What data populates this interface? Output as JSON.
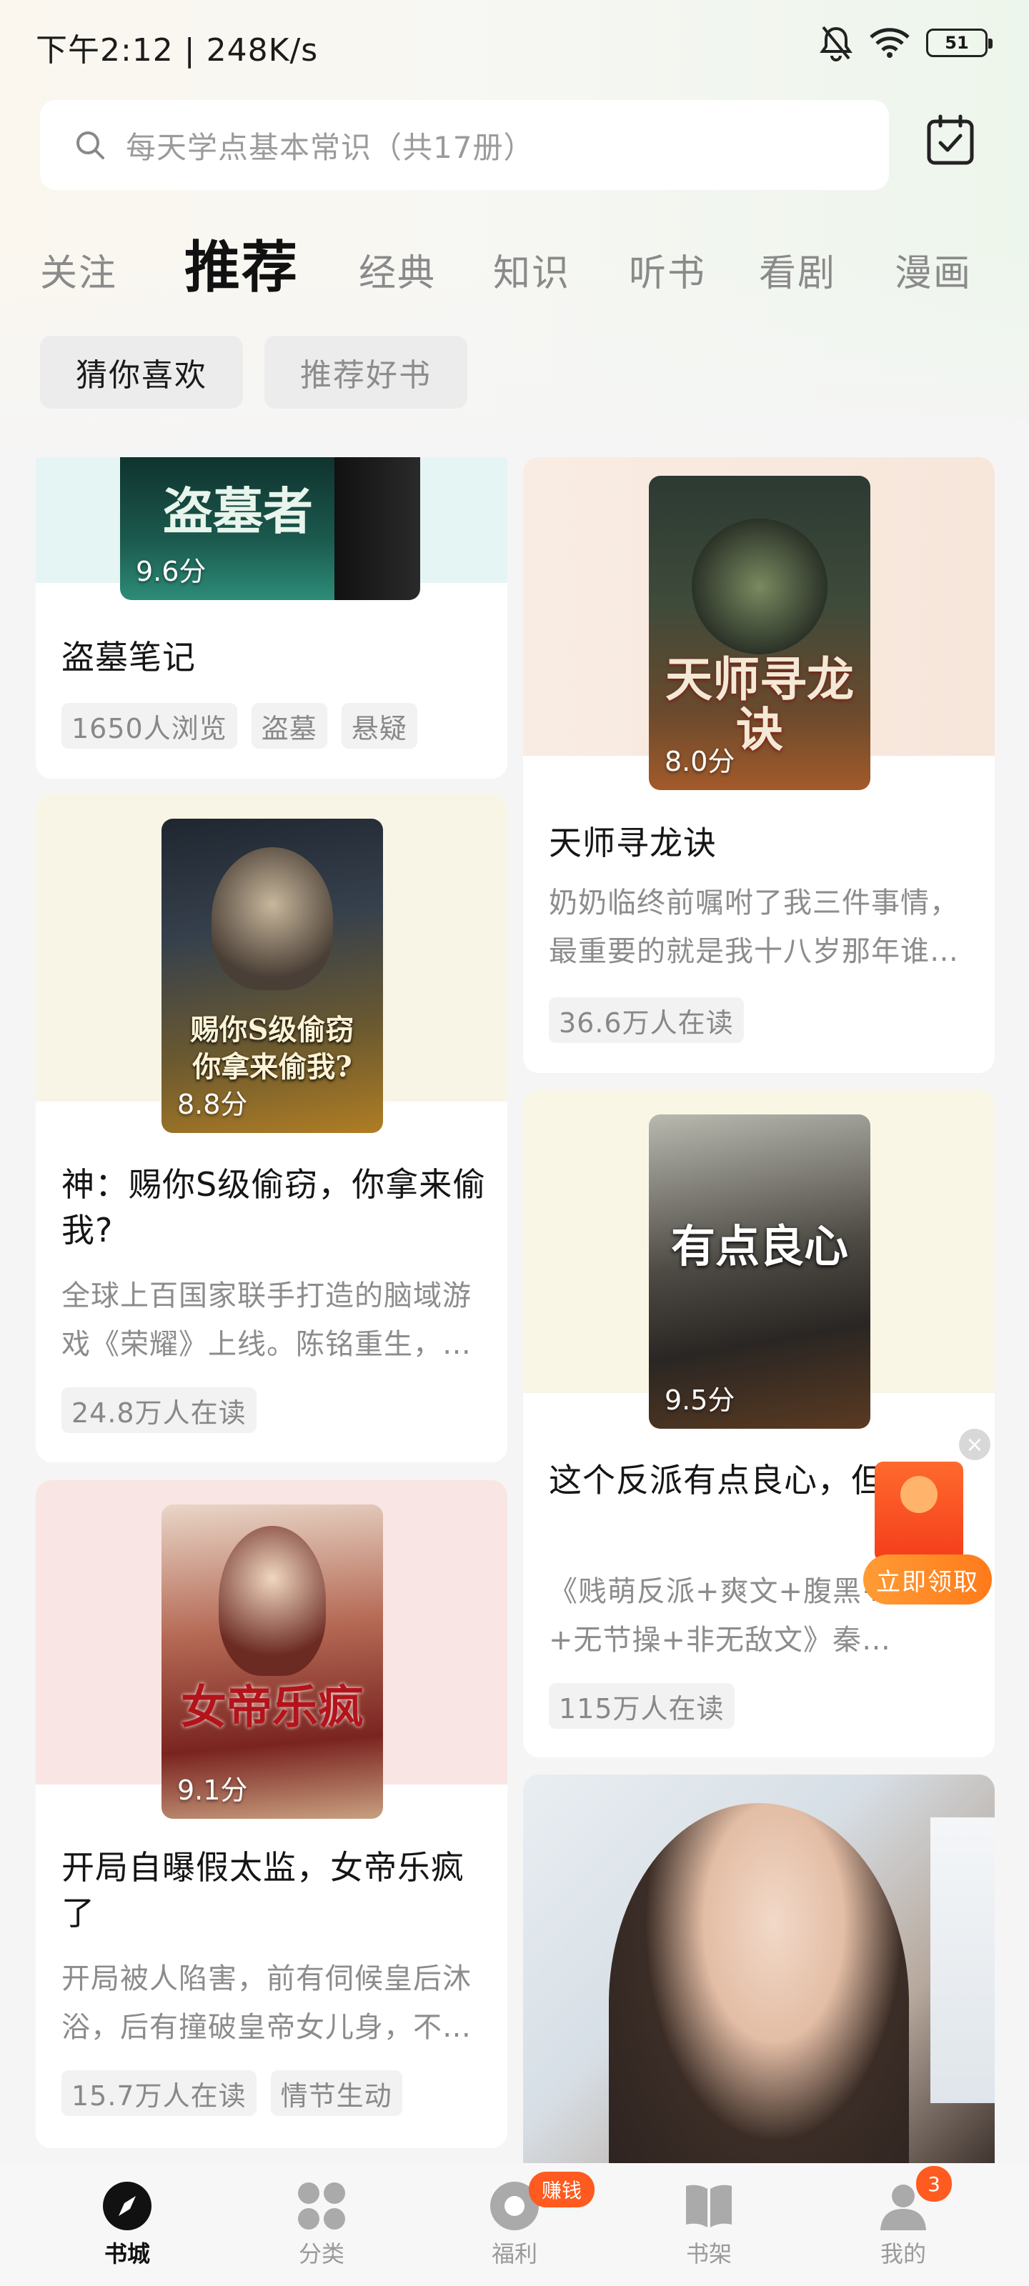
{
  "status": {
    "time": "下午2:12 | 248K/s",
    "battery": "51"
  },
  "search": {
    "placeholder": "每天学点基本常识（共17册）"
  },
  "tabs": [
    "关注",
    "推荐",
    "经典",
    "知识",
    "听书",
    "看剧",
    "漫画"
  ],
  "active_tab": "推荐",
  "chips": [
    "猜你喜欢",
    "推荐好书"
  ],
  "cards": [
    {
      "title": "盗墓笔记",
      "score": "9.6分",
      "cover_text": "盗墓者",
      "tags": [
        "1650人浏览",
        "盗墓",
        "悬疑"
      ]
    },
    {
      "title": "天师寻龙诀",
      "score": "8.0分",
      "cover_text": "天师寻龙诀",
      "desc": "奶奶临终前嘱咐了我三件事情，最重要的就是我十八岁那年谁…",
      "tags": [
        "36.6万人在读"
      ]
    },
    {
      "title": "神：赐你S级偷窃，你拿来偷我?",
      "score": "8.8分",
      "cover_text": "赐你S级偷窃 你拿来偷我?",
      "desc": "全球上百国家联手打造的脑域游戏《荣耀》上线。陈铭重生，…",
      "tags": [
        "24.8万人在读"
      ]
    },
    {
      "title": "这个反派有点良心，但不多!",
      "score": "9.5分",
      "cover_text": "有点良心",
      "desc": "《贱萌反派+爽文+腹黑+老六+无节操+非无敌文》秦…",
      "tags": [
        "115万人在读"
      ]
    },
    {
      "title": "开局自曝假太监，女帝乐疯了",
      "score": "9.1分",
      "cover_text": "女帝乐疯",
      "desc": "开局被人陷害，前有伺候皇后沐浴，后有撞破皇帝女儿身，不…",
      "tags": [
        "15.7万人在读",
        "情节生动"
      ]
    }
  ],
  "redpack": {
    "button": "立即领取",
    "close": "×"
  },
  "nav": [
    {
      "label": "书城",
      "icon": "compass-icon"
    },
    {
      "label": "分类",
      "icon": "grid-icon"
    },
    {
      "label": "福利",
      "icon": "gift-icon",
      "badge": "赚钱"
    },
    {
      "label": "书架",
      "icon": "book-icon"
    },
    {
      "label": "我的",
      "icon": "user-icon",
      "badge": "3"
    }
  ],
  "colors": {
    "accent": "#ff5a1f",
    "text": "#151515",
    "muted": "#8c8c8c"
  }
}
